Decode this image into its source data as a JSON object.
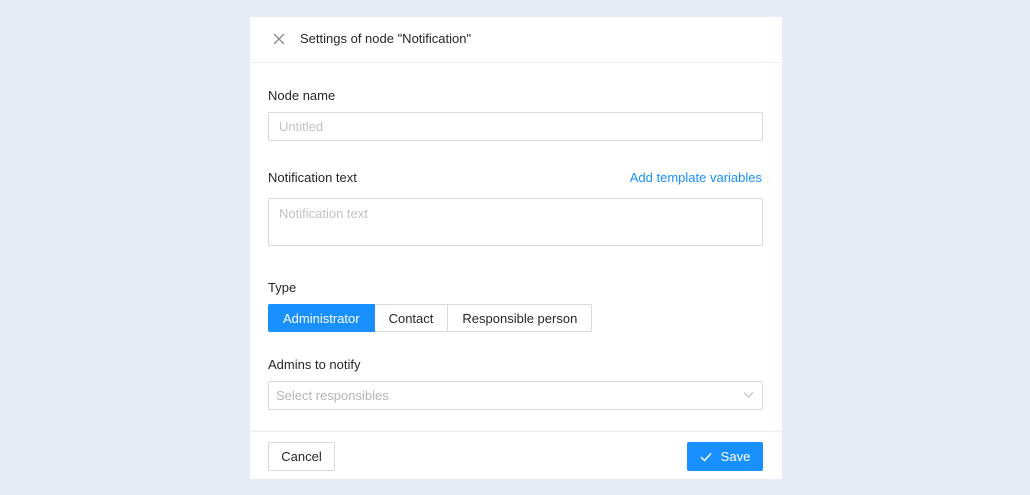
{
  "dialog": {
    "title": "Settings of node \"Notification\"",
    "close_icon": "close-icon"
  },
  "fields": {
    "node_name": {
      "label": "Node name",
      "value": "",
      "placeholder": "Untitled"
    },
    "notification_text": {
      "label": "Notification text",
      "value": "",
      "placeholder": "Notification text",
      "link_label": "Add template variables"
    },
    "type": {
      "label": "Type",
      "options": [
        "Administrator",
        "Contact",
        "Responsible person"
      ],
      "selected": "Administrator"
    },
    "admins": {
      "label": "Admins to notify",
      "placeholder": "Select responsibles",
      "arrow_icon": "chevron-down-icon"
    }
  },
  "footer": {
    "cancel_label": "Cancel",
    "save_label": "Save",
    "save_icon": "check-icon"
  },
  "colors": {
    "accent": "#1890ff",
    "background": "#e5ecf5",
    "border": "#d9d9d9"
  }
}
